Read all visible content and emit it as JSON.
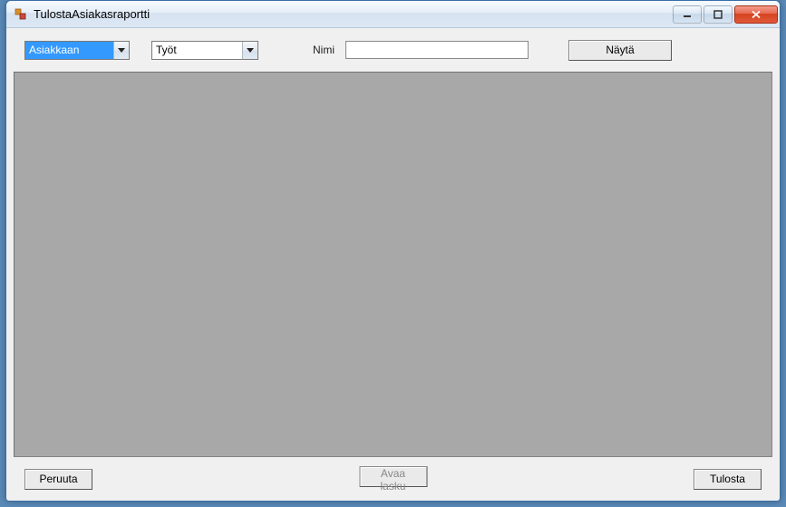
{
  "window": {
    "title": "TulostaAsiakasraportti"
  },
  "toolbar": {
    "combo1_selected": "Asiakkaan",
    "combo2_selected": "Työt",
    "label_nimi": "Nimi",
    "input_value": "",
    "nayta_label": "Näytä"
  },
  "footer": {
    "peruuta_label": "Peruuta",
    "avaa_lasku_label": "Avaa lasku",
    "tulosta_label": "Tulosta"
  }
}
